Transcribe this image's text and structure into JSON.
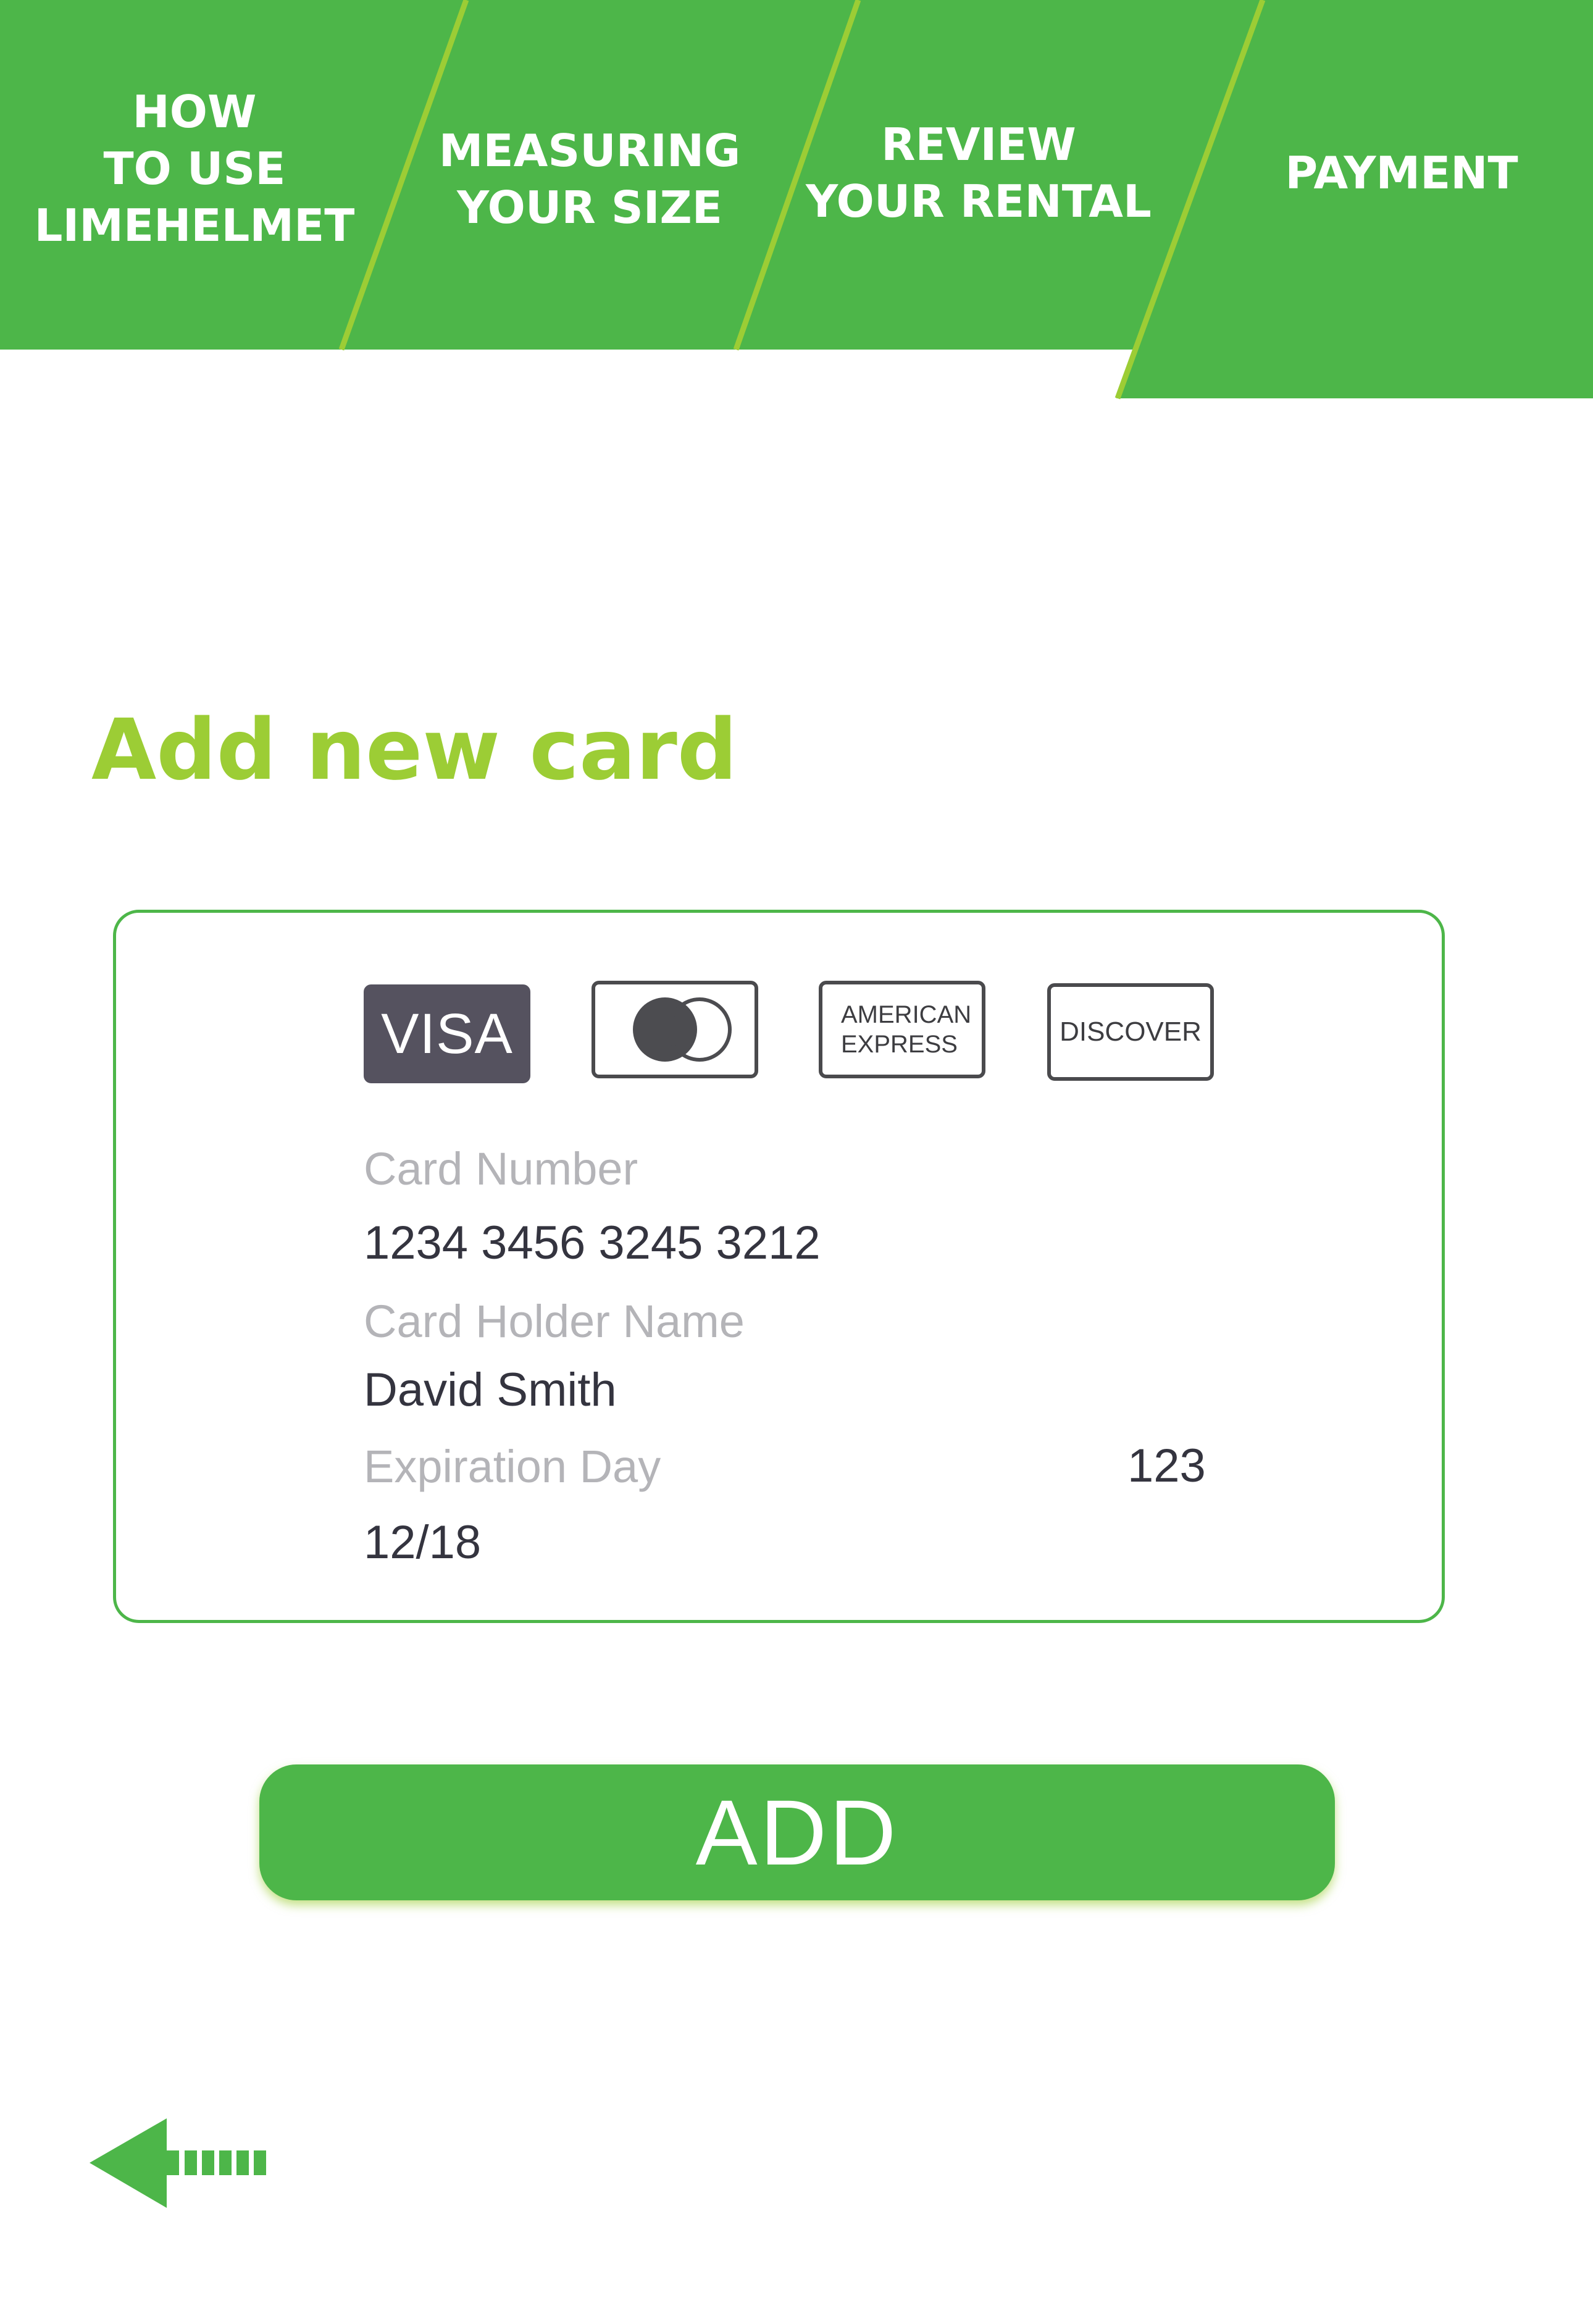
{
  "nav": {
    "tabs": [
      {
        "lines": [
          "HOW",
          "TO USE",
          "LIMEHELMET"
        ]
      },
      {
        "lines": [
          "MEASURING",
          "YOUR SIZE"
        ]
      },
      {
        "lines": [
          "REVIEW",
          "YOUR RENTAL"
        ]
      },
      {
        "lines": [
          "PAYMENT"
        ],
        "active": true
      }
    ]
  },
  "colors": {
    "primary_green": "#4db649",
    "lime_accent": "#9ccd35",
    "dark_text": "#34343f",
    "muted_label": "#b4b4b8"
  },
  "page_title": "Add new card",
  "card_brands": {
    "visa": "VISA",
    "mastercard_icon": "mastercard-icon",
    "amex_line1": "AMERICAN",
    "amex_line2": "EXPRESS",
    "discover": "DISCOVER",
    "selected": "VISA"
  },
  "form": {
    "card_number_label": "Card Number",
    "card_number_value": "1234 3456 3245 3212",
    "holder_label": "Card Holder Name",
    "holder_value": "David Smith",
    "expiration_label": "Expiration Day",
    "expiration_value": "12/18",
    "cvv_value": "123"
  },
  "add_button_label": "ADD",
  "back_icon": "back-arrow-icon"
}
